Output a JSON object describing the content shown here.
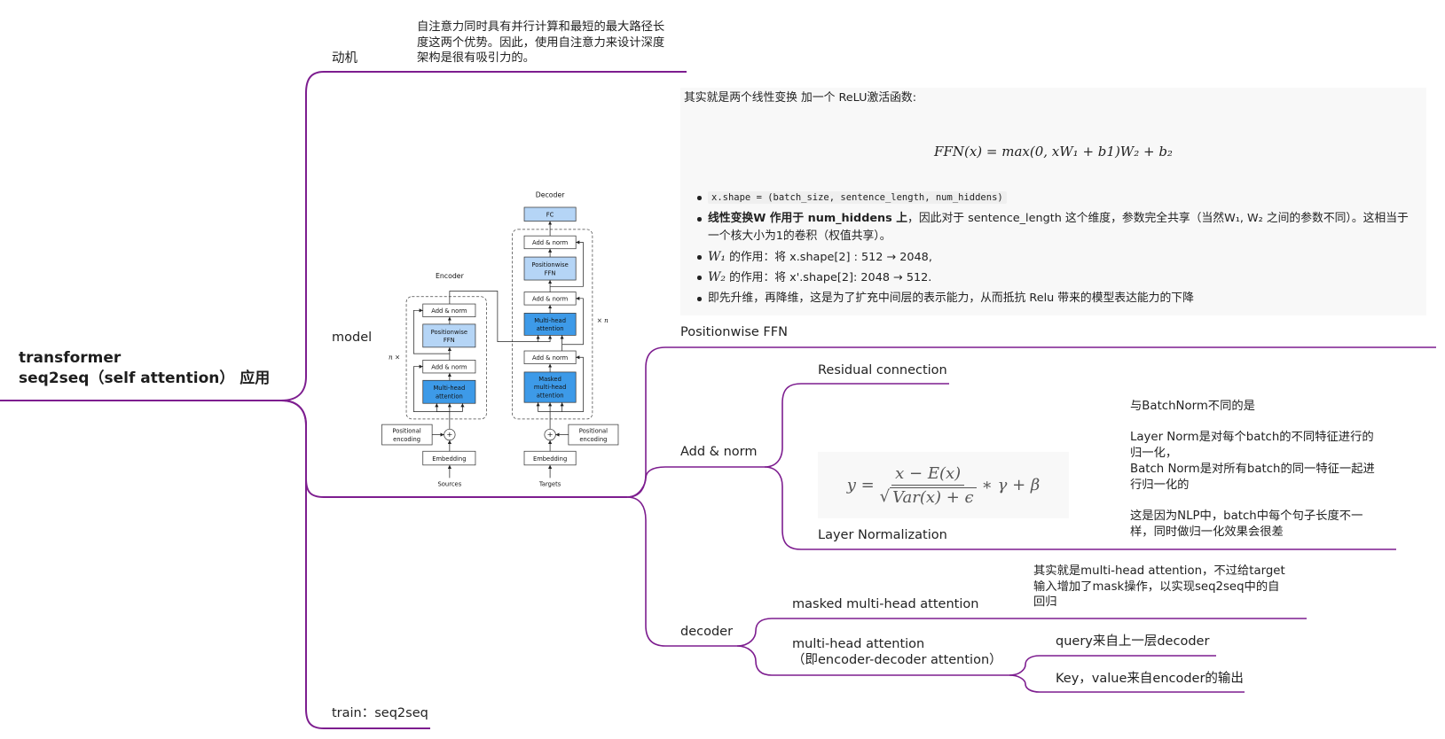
{
  "colors": {
    "branch_line": "#7d1d8f",
    "note_background": "#f8f8f8",
    "ffn_block": "#b5d5f6",
    "attention_block": "#3d9ae8",
    "text": "#222222"
  },
  "root": {
    "lines": [
      "transformer",
      "seq2seq（self attention） 应用"
    ]
  },
  "motivation": {
    "label": "动机",
    "note": [
      "自注意力同时具有并行计算和最短的最大路径长",
      "度这两个优势。因此，使用自注意力来设计深度",
      "架构是很有吸引力的。"
    ]
  },
  "model": {
    "label": "model",
    "architecture": {
      "decoder_title": "Decoder",
      "encoder_title": "Encoder",
      "fc": "FC",
      "add_norm": "Add & norm",
      "ffn": [
        "Positionwise",
        "FFN"
      ],
      "multi_head": [
        "Multi-head",
        "attention"
      ],
      "masked": [
        "Masked",
        "multi-head",
        "attention"
      ],
      "positional_encoding": [
        "Positional",
        "encoding"
      ],
      "embedding": "Embedding",
      "sources": "Sources",
      "targets": "Targets",
      "repeat_encoder": "n ×",
      "repeat_decoder": "× n",
      "plus": "+"
    },
    "positionwise_ffn": {
      "label": "Positionwise FFN",
      "note": {
        "intro": "其实就是两个线性变换 加一个 ReLU激活函数:",
        "formula": "FFN(x) = max(0, xW₁ + b1)W₂ + b₂",
        "bullets": [
          {
            "code": "x.shape = (batch_size, sentence_length, num_hiddens)"
          },
          {
            "bold": "线性变换W  作用于 num_hiddens 上",
            "text": "，因此对于 sentence_length 这个维度，参数完全共享（当然W₁, W₂ 之间的参数不同）。这相当于一个核大小为1的卷积（权值共享）。"
          },
          {
            "symbol": "W₁",
            "text": " 的作用：将 x.shape[2] : 512 → 2048,"
          },
          {
            "symbol": "W₂",
            "text": " 的作用：将 x'.shape[2]: 2048 → 512."
          },
          {
            "text": "即先升维，再降维，这是为了扩充中间层的表示能力，从而抵抗 Relu 带来的模型表达能力的下降"
          }
        ]
      }
    },
    "add_norm": {
      "label": "Add & norm",
      "residual": "Residual connection",
      "layer_norm": {
        "label": "Layer Normalization",
        "formula": {
          "lhs": "y =",
          "numerator": "x − E(x)",
          "radical": "√",
          "denominator": "Var(x) + ϵ",
          "rhs": "∗ γ + β"
        },
        "note": [
          [
            "与BatchNorm不同的是"
          ],
          [
            "Layer Norm是对每个batch的不同特征进行的",
            "归一化，",
            "Batch Norm是对所有batch的同一特征一起进",
            "行归一化的"
          ],
          [
            "这是因为NLP中，batch中每个句子长度不一",
            "样，同时做归一化效果会很差"
          ]
        ]
      }
    },
    "decoder": {
      "label": "decoder",
      "masked": {
        "label": "masked multi-head attention",
        "note": [
          "其实就是multi-head attention，不过给target",
          "输入增加了mask操作，以实现seq2seq中的自",
          "回归"
        ]
      },
      "cross": {
        "label": [
          "multi-head attention",
          "（即encoder-decoder attention）"
        ],
        "query": "query来自上一层decoder",
        "key": "Key，value来自encoder的输出"
      }
    }
  },
  "train": {
    "label": "train：seq2seq"
  }
}
